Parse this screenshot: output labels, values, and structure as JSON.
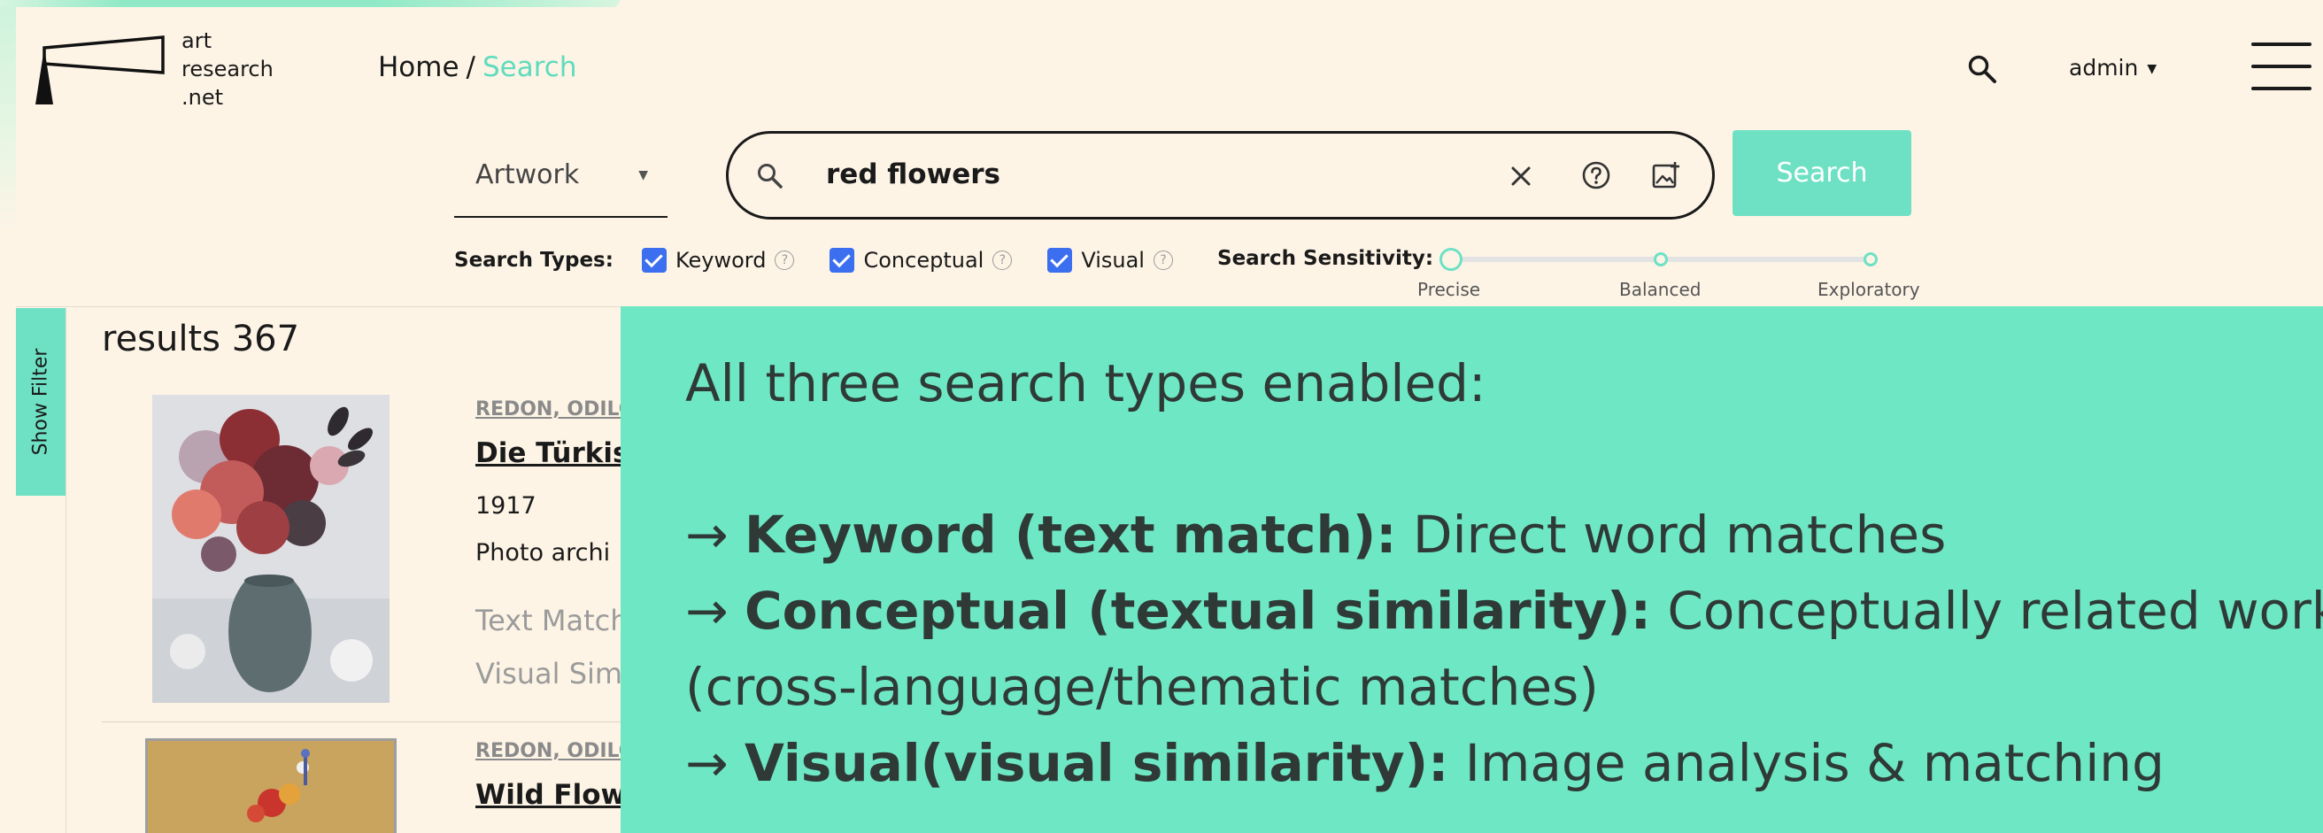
{
  "logo": {
    "line1": "art",
    "line2": "research",
    "line3": ".net"
  },
  "breadcrumb": {
    "home": "Home",
    "separator": "/",
    "current": "Search"
  },
  "header": {
    "user": "admin"
  },
  "search": {
    "type_value": "Artwork",
    "query": "red flowers",
    "button_label": "Search"
  },
  "search_types": {
    "label": "Search Types:",
    "options": [
      {
        "label": "Keyword",
        "checked": true
      },
      {
        "label": "Conceptual",
        "checked": true
      },
      {
        "label": "Visual",
        "checked": true
      }
    ]
  },
  "sensitivity": {
    "label": "Search Sensitivity:",
    "levels": [
      "Precise",
      "Balanced",
      "Exploratory"
    ],
    "selected": "Precise"
  },
  "filter": {
    "label": "Show Filter"
  },
  "results": {
    "heading": "results 367",
    "items": [
      {
        "artist": "REDON, ODILO",
        "title": "Die Türkis",
        "year": "1917",
        "source": "Photo archi",
        "text_match": "Text Match",
        "visual_sim": "Visual Sim"
      },
      {
        "artist": "REDON, ODILO",
        "title": "Wild Flow"
      }
    ]
  },
  "callout": {
    "intro": "All three search types enabled:",
    "arrow": "→",
    "items": [
      {
        "term": "Keyword (text match):",
        "desc": "Direct word matches"
      },
      {
        "term": "Conceptual (textual similarity):",
        "desc": "Conceptually related works"
      },
      {
        "term": "Visual(visual similarity):",
        "desc": "Image analysis & matching"
      }
    ],
    "continuation": "(cross-language/thematic matches)"
  },
  "colors": {
    "accent": "#6ee1c4",
    "overlay": "#6ee8c4",
    "background": "#fdf4e6",
    "checkbox": "#3b6ff0"
  }
}
